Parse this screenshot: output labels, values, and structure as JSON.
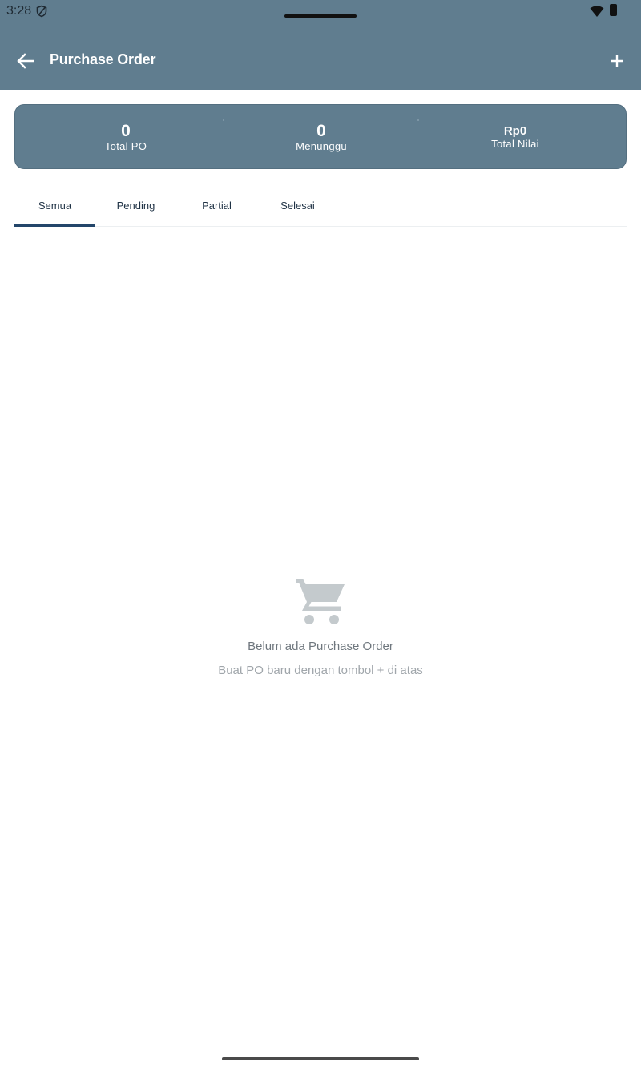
{
  "status_bar": {
    "time": "3:28"
  },
  "app_bar": {
    "title": "Purchase Order"
  },
  "summary": {
    "total_po_value": "0",
    "total_po_label": "Total PO",
    "waiting_value": "0",
    "waiting_label": "Menunggu",
    "total_value_value": "Rp0",
    "total_value_label": "Total Nilai"
  },
  "tabs": [
    {
      "label": "Semua",
      "active": true
    },
    {
      "label": "Pending",
      "active": false
    },
    {
      "label": "Partial",
      "active": false
    },
    {
      "label": "Selesai",
      "active": false
    }
  ],
  "empty_state": {
    "title": "Belum ada Purchase Order",
    "subtitle": "Buat PO baru dengan tombol + di atas"
  },
  "colors": {
    "app_bar": "#607d8f",
    "tab_indicator": "#23466a",
    "empty_icon": "#c4cacd"
  },
  "icons": [
    "back-arrow-icon",
    "add-icon",
    "shopping-cart-icon",
    "shield-icon",
    "wifi-icon",
    "battery-icon"
  ]
}
